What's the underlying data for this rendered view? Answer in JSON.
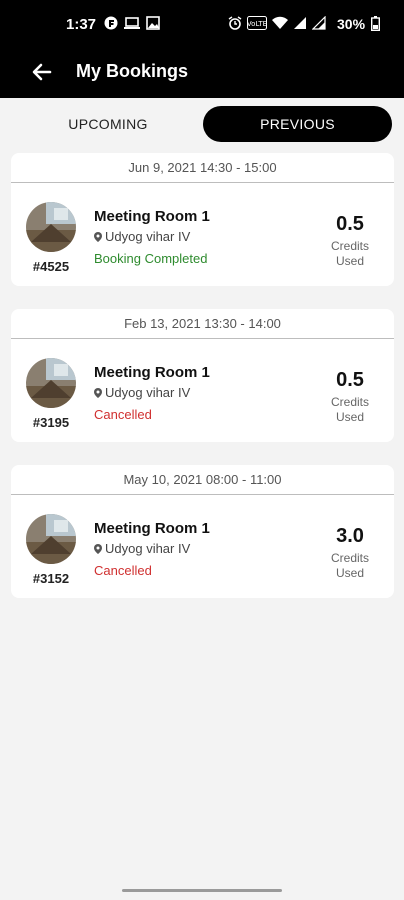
{
  "status_bar": {
    "time": "1:37",
    "battery": "30%",
    "icons_left": [
      "f-icon",
      "laptop-icon",
      "image-icon"
    ],
    "icons_right": [
      "alarm-icon",
      "volte-icon",
      "wifi-icon",
      "signal-icon",
      "signal-icon-2",
      "battery-icon"
    ]
  },
  "app_bar": {
    "title": "My Bookings",
    "back_icon": "arrow-left-icon"
  },
  "tabs": [
    {
      "label": "UPCOMING",
      "active": false
    },
    {
      "label": "PREVIOUS",
      "active": true
    }
  ],
  "bookings": [
    {
      "date": "Jun 9, 2021 14:30 - 15:00",
      "room": "Meeting Room 1",
      "location": "Udyog vihar IV",
      "status": "Booking Completed",
      "status_color": "#2e8b2e",
      "id": "#4525",
      "credits": "0.5",
      "credits_label_1": "Credits",
      "credits_label_2": "Used"
    },
    {
      "date": "Feb 13, 2021 13:30 - 14:00",
      "room": "Meeting Room 1",
      "location": "Udyog vihar IV",
      "status": "Cancelled",
      "status_color": "#d03030",
      "id": "#3195",
      "credits": "0.5",
      "credits_label_1": "Credits",
      "credits_label_2": "Used"
    },
    {
      "date": "May 10, 2021 08:00 - 11:00",
      "room": "Meeting Room 1",
      "location": "Udyog vihar IV",
      "status": "Cancelled",
      "status_color": "#d03030",
      "id": "#3152",
      "credits": "3.0",
      "credits_label_1": "Credits",
      "credits_label_2": "Used"
    }
  ],
  "colors": {
    "header_bg": "#000000",
    "accent_active_tab": "#000000",
    "completed": "#2e8b2e",
    "cancelled": "#d03030"
  }
}
